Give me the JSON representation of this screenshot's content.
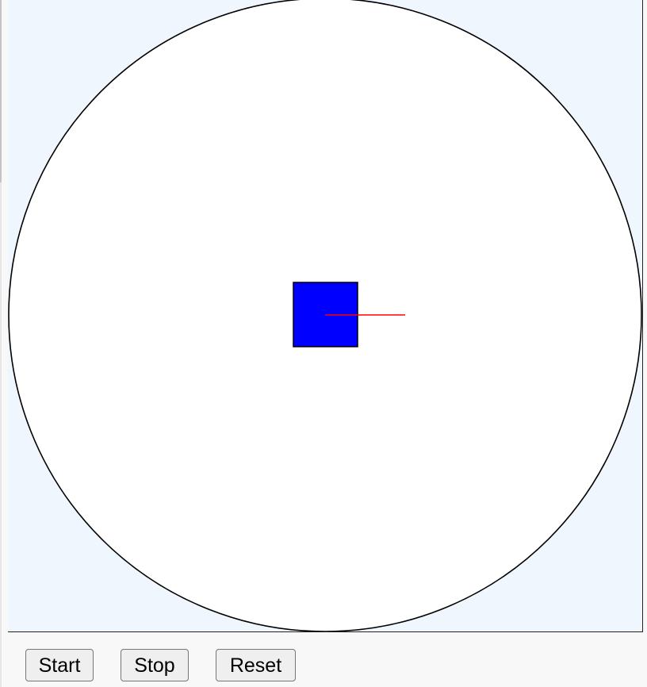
{
  "canvas": {
    "background_color": "#f0f6fe",
    "arena_fill": "#ffffff",
    "arena_stroke": "#000000",
    "robot_fill": "#0000ff",
    "robot_stroke": "#000000",
    "heading_color": "#ff0000"
  },
  "controls": {
    "start_label": "Start",
    "stop_label": "Stop",
    "reset_label": "Reset"
  }
}
